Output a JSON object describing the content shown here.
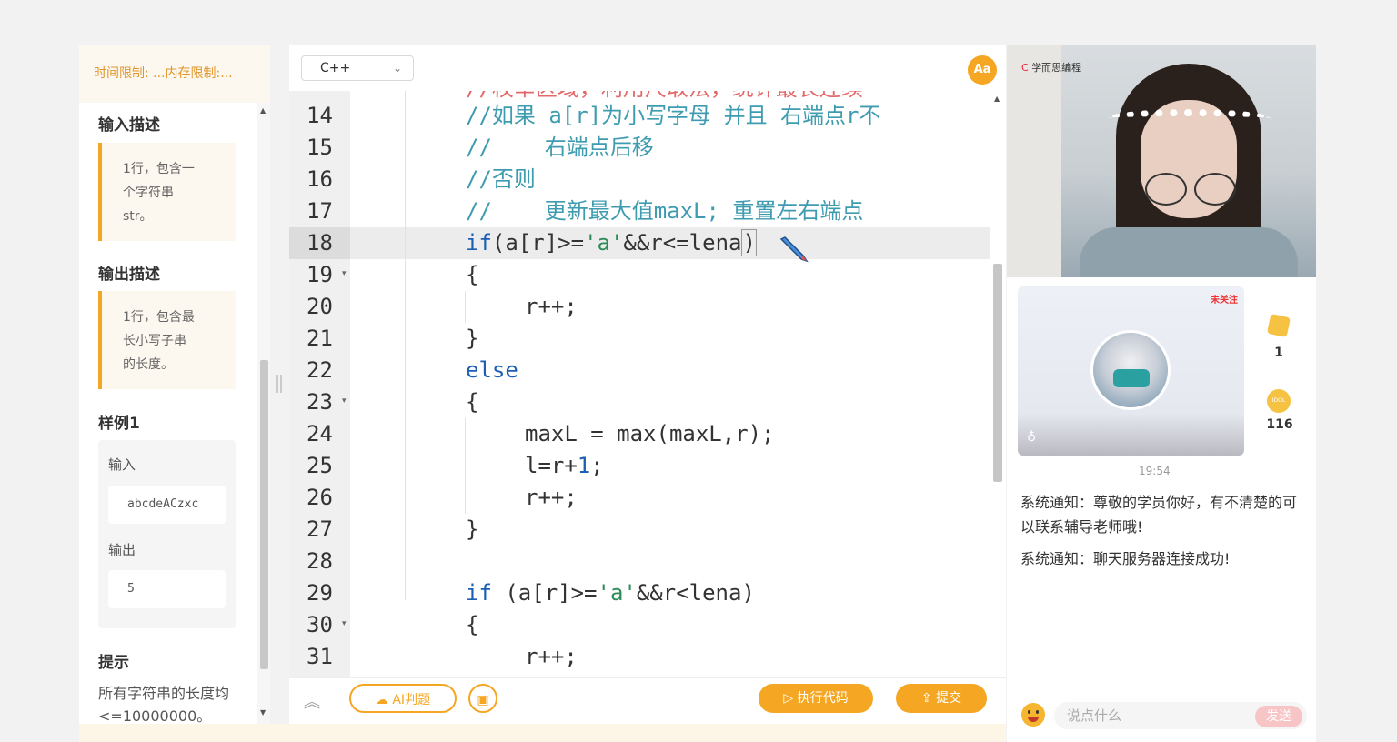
{
  "problem": {
    "limits": "时间限制: ...内存限制:...",
    "input_title": "输入描述",
    "input_desc": [
      "1行，包含一",
      "个字符串",
      "str。"
    ],
    "output_title": "输出描述",
    "output_desc": [
      "1行，包含最",
      "长小写子串",
      "的长度。"
    ],
    "sample_title": "样例1",
    "sample_input_label": "输入",
    "sample_input": "abcdeACzxc",
    "sample_output_label": "输出",
    "sample_output": "5",
    "hint_title": "提示",
    "hint_text": "所有字符串的长度均<=10000000。"
  },
  "editor": {
    "language": "C++",
    "font_button": "Aa",
    "line_numbers": [
      "14",
      "15",
      "16",
      "17",
      "18",
      "19",
      "20",
      "21",
      "22",
      "23",
      "24",
      "25",
      "26",
      "27",
      "28",
      "29",
      "30",
      "31"
    ],
    "partial_top_line": "//枚举区域，利用尺取法，统计最长连续",
    "code": {
      "l14": "//如果 a[r]为小写字母 并且 右端点r不",
      "l15": "//    右端点后移",
      "l16": "//否则",
      "l17": "//    更新最大值maxL; 重置左右端点",
      "l18_kw": "if",
      "l18_a": "(a[r]>=",
      "l18_str": "'a'",
      "l18_b": "&&r<=lena",
      "l18_c": ")",
      "l19": "{",
      "l20": "r++;",
      "l21": "}",
      "l22": "else",
      "l23": "{",
      "l24": "maxL = max(maxL,r);",
      "l25_a": "l=r+",
      "l25_num": "1",
      "l25_b": ";",
      "l26": "r++;",
      "l27": "}",
      "l29_kw": "if",
      "l29_a": " (a[r]>=",
      "l29_str": "'a'",
      "l29_b": "&&r<lena)",
      "l30": "{",
      "l31": "r++;"
    },
    "ai_button": "AI判题",
    "run_button": "执行代码",
    "submit_button": "提交"
  },
  "right": {
    "brand": "学而思编程",
    "card_badge": "未关注",
    "cards_count": "1",
    "coins_count": "116",
    "coin_label": "IDOL",
    "timestamp": "19:54",
    "messages": [
      "系统通知：尊敬的学员你好，有不清楚的可以联系辅导老师哦!",
      "系统通知：聊天服务器连接成功!"
    ],
    "chat_placeholder": "说点什么",
    "send_button": "发送"
  },
  "colors": {
    "accent": "#f5a623",
    "comment": "#3f9cb0",
    "keyword": "#1a5fb4",
    "string": "#2e8b57"
  }
}
